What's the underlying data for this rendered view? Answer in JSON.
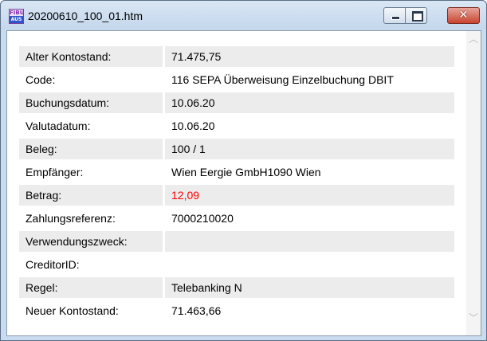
{
  "window": {
    "title": "20200610_100_01.htm",
    "app_icon": {
      "top_text": "FIBU",
      "bottom_text": "AUS"
    },
    "controls": [
      "minimize-icon",
      "maximize-icon",
      "close-icon"
    ]
  },
  "rows": [
    {
      "label": "Alter Kontostand:",
      "value": "71.475,75"
    },
    {
      "label": "Code:",
      "value": "116 SEPA Überweisung Einzelbuchung DBIT"
    },
    {
      "label": "Buchungsdatum:",
      "value": "10.06.20"
    },
    {
      "label": "Valutadatum:",
      "value": "10.06.20"
    },
    {
      "label": "Beleg:",
      "value": "100 / 1"
    },
    {
      "label": "Empfänger:",
      "value": "Wien Eergie GmbH1090 Wien"
    },
    {
      "label": "Betrag:",
      "value": "12,09"
    },
    {
      "label": "Zahlungsreferenz:",
      "value": "7000210020"
    },
    {
      "label": "Verwendungszweck:",
      "value": ""
    },
    {
      "label": "CreditorID:",
      "value": ""
    },
    {
      "label": "Regel:",
      "value": "Telebanking N"
    },
    {
      "label": "Neuer Kontostand:",
      "value": "71.463,66"
    }
  ],
  "colors": {
    "row_shade": "#ececec",
    "amount": "#ff0000",
    "titlebar": "#c9dbee",
    "close_button": "#c8442f"
  }
}
